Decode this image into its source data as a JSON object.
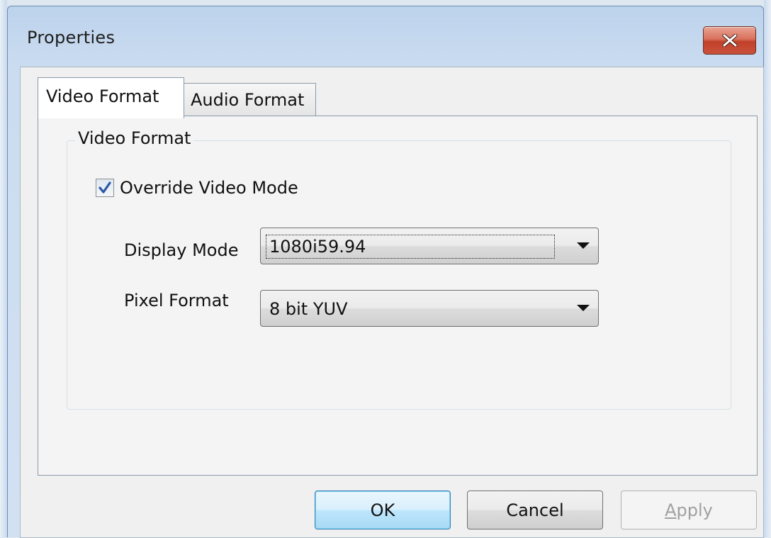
{
  "window": {
    "title": "Properties"
  },
  "tabs": [
    {
      "label": "Video Format",
      "selected": true
    },
    {
      "label": "Audio Format",
      "selected": false
    }
  ],
  "video_format_group": {
    "label": "Video Format",
    "override_checkbox": {
      "label": "Override Video Mode",
      "checked": true
    },
    "display_mode": {
      "label": "Display Mode",
      "value": "1080i59.94"
    },
    "pixel_format": {
      "label": "Pixel Format",
      "value": "8 bit YUV"
    }
  },
  "buttons": {
    "ok": "OK",
    "cancel": "Cancel",
    "apply_first": "A",
    "apply_rest": "pply",
    "apply_enabled": false
  },
  "colors": {
    "close_button": "#c9513b",
    "checkmark": "#2c58a8",
    "default_button_border": "#3c7fb1"
  },
  "icons": {
    "close": "close-icon",
    "checkmark": "checkmark-icon",
    "dropdown": "chevron-down-icon"
  }
}
